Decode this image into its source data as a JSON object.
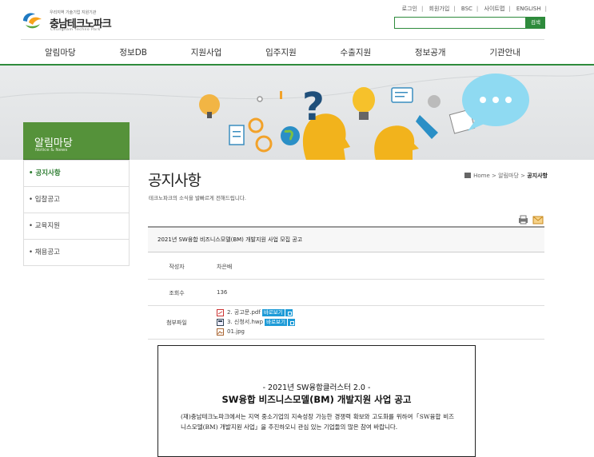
{
  "header": {
    "logo_tagline": "우리지역 기술기업 지원기관",
    "logo_name": "충남테크노파크",
    "logo_en": "Chungnam Techno Park",
    "util_links": [
      "로그인",
      "회원가입",
      "BSC",
      "사이트맵",
      "ENGLISH"
    ],
    "search_button": "검색",
    "search_value": ""
  },
  "gnb": [
    "알림마당",
    "정보DB",
    "지원사업",
    "입주지원",
    "수출지원",
    "정보공개",
    "기관안내"
  ],
  "sidebar": {
    "title": "알림마당",
    "subtitle": "Notice & News",
    "items": [
      {
        "label": "• 공지사항",
        "active": true
      },
      {
        "label": "• 입찰공고",
        "active": false
      },
      {
        "label": "• 교육지원",
        "active": false
      },
      {
        "label": "• 채용공고",
        "active": false
      }
    ]
  },
  "content": {
    "title": "공지사항",
    "description": "테크노파크의 소식을 발빠르게 전해드립니다.",
    "breadcrumb": {
      "home": "Home",
      "level1": "알림마당",
      "current": "공지사항"
    },
    "post_title": "2021년 SW융합 비즈니스모델(BM) 개발지원 사업 모집 공고",
    "author_label": "작성자",
    "author": "차은배",
    "views_label": "조회수",
    "views": "136",
    "files_label": "첨부파일",
    "files": [
      {
        "name": "2. 공고문.pdf",
        "type": "pdf",
        "view": "바로보기"
      },
      {
        "name": "3. 신청서.hwp",
        "type": "hwp",
        "view": "바로보기"
      },
      {
        "name": "01.jpg",
        "type": "jpg",
        "view": ""
      }
    ],
    "document": {
      "line1": "- 2021년 SW융합클러스터 2.0 -",
      "line2": "SW융합 비즈니스모델(BM) 개발지원 사업 공고",
      "body": "(재)충남테크노파크에서는 지역 중소기업의 지속성장 가능한 경쟁력 확보와 고도화를 위하여「SW융합 비즈니스모델(BM) 개발지원 사업」을 추진하오니 관심 있는 기업들의 많은 참여 바랍니다."
    }
  },
  "colors": {
    "brand_green": "#2e8b3c",
    "side_green": "#55923a",
    "view_blue": "#1e9bd7"
  }
}
